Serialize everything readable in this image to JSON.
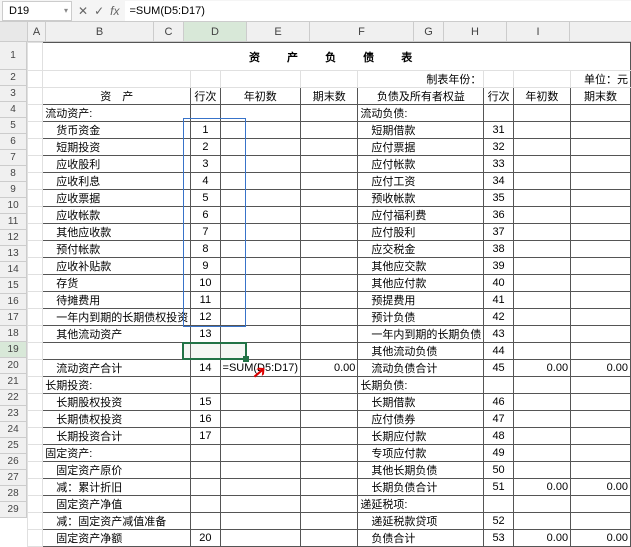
{
  "formula_bar": {
    "cell_ref": "D19",
    "formula": "=SUM(D5:D17)"
  },
  "columns": [
    "A",
    "B",
    "C",
    "D",
    "E",
    "F",
    "G",
    "H",
    "I"
  ],
  "title": "资 产 负 债 表",
  "meta": {
    "left": "制表年份：",
    "right": "单位：元"
  },
  "headers": {
    "b": "资　产",
    "c": "行次",
    "d": "年初数",
    "e": "期末数",
    "f": "负债及所有者权益",
    "g": "行次",
    "h": "年初数",
    "i": "期末数"
  },
  "rows": [
    {
      "r": 4,
      "b": "流动资产:",
      "c": "",
      "f": "流动负债:",
      "g": ""
    },
    {
      "r": 5,
      "b": "　货币资金",
      "c": "1",
      "f": "　短期借款",
      "g": "31"
    },
    {
      "r": 6,
      "b": "　短期投资",
      "c": "2",
      "f": "　应付票据",
      "g": "32"
    },
    {
      "r": 7,
      "b": "　应收股利",
      "c": "3",
      "f": "　应付帐款",
      "g": "33"
    },
    {
      "r": 8,
      "b": "　应收利息",
      "c": "4",
      "f": "　应付工资",
      "g": "34"
    },
    {
      "r": 9,
      "b": "　应收票据",
      "c": "5",
      "f": "　预收帐款",
      "g": "35"
    },
    {
      "r": 10,
      "b": "　应收帐款",
      "c": "6",
      "f": "　应付福利费",
      "g": "36"
    },
    {
      "r": 11,
      "b": "　其他应收款",
      "c": "7",
      "f": "　应付股利",
      "g": "37"
    },
    {
      "r": 12,
      "b": "　预付帐款",
      "c": "8",
      "f": "　应交税金",
      "g": "38"
    },
    {
      "r": 13,
      "b": "　应收补贴款",
      "c": "9",
      "f": "　其他应交款",
      "g": "39"
    },
    {
      "r": 14,
      "b": "　存货",
      "c": "10",
      "f": "　其他应付款",
      "g": "40"
    },
    {
      "r": 15,
      "b": "　待摊费用",
      "c": "11",
      "f": "　预提费用",
      "g": "41"
    },
    {
      "r": 16,
      "b": "　一年内到期的长期债权投资",
      "c": "12",
      "f": "　预计负债",
      "g": "42"
    },
    {
      "r": 17,
      "b": "　其他流动资产",
      "c": "13",
      "f": "　一年内到期的长期负债",
      "g": "43"
    },
    {
      "r": 18,
      "b": "",
      "c": "",
      "f": "　其他流动负债",
      "g": "44"
    },
    {
      "r": 19,
      "b": "　流动资产合计",
      "c": "14",
      "d": "=SUM(D5:D17)",
      "e": "0.00",
      "f": "　流动负债合计",
      "g": "45",
      "h": "0.00",
      "i": "0.00"
    },
    {
      "r": 20,
      "b": "长期投资:",
      "c": "",
      "f": "长期负债:",
      "g": ""
    },
    {
      "r": 21,
      "b": "　长期股权投资",
      "c": "15",
      "f": "　长期借款",
      "g": "46"
    },
    {
      "r": 22,
      "b": "　长期债权投资",
      "c": "16",
      "f": "　应付债券",
      "g": "47"
    },
    {
      "r": 23,
      "b": "　长期投资合计",
      "c": "17",
      "f": "　长期应付款",
      "g": "48"
    },
    {
      "r": 24,
      "b": "固定资产:",
      "c": "",
      "f": "　专项应付款",
      "g": "49"
    },
    {
      "r": 25,
      "b": "　固定资产原价",
      "c": "",
      "f": "　其他长期负债",
      "g": "50"
    },
    {
      "r": 26,
      "b": "　减：累计折旧",
      "c": "",
      "f": "　长期负债合计",
      "g": "51",
      "h": "0.00",
      "i": "0.00"
    },
    {
      "r": 27,
      "b": "　固定资产净值",
      "c": "",
      "f": "递延税项:",
      "g": ""
    },
    {
      "r": 28,
      "b": "　减：固定资产减值准备",
      "c": "",
      "f": "　递延税款贷项",
      "g": "52"
    },
    {
      "r": 29,
      "b": "　固定资产净额",
      "c": "20",
      "f": "　负债合计",
      "g": "53",
      "h": "0.00",
      "i": "0.00"
    }
  ],
  "chart_data": null
}
